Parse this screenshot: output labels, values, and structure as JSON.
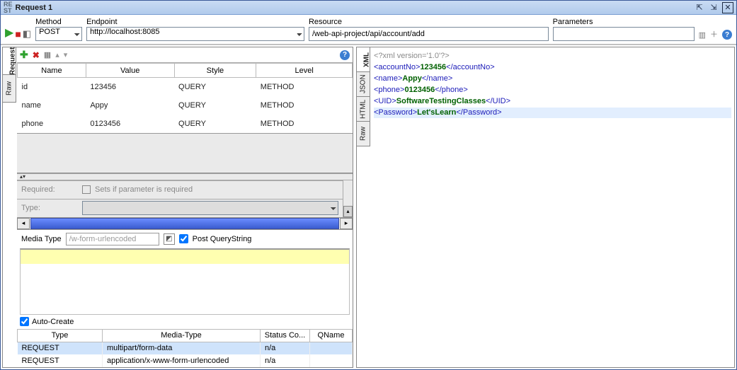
{
  "title": "Request 1",
  "urlbar": {
    "method_label": "Method",
    "method_value": "POST",
    "endpoint_label": "Endpoint",
    "endpoint_value": "http://localhost:8085",
    "resource_label": "Resource",
    "resource_value": "/web-api-project/api/account/add",
    "params_label": "Parameters",
    "params_value": ""
  },
  "left_tabs": [
    "Request",
    "Raw"
  ],
  "param_headers": [
    "Name",
    "Value",
    "Style",
    "Level"
  ],
  "params": [
    {
      "name": "id",
      "value": "123456",
      "style": "QUERY",
      "level": "METHOD"
    },
    {
      "name": "name",
      "value": "Appy",
      "style": "QUERY",
      "level": "METHOD"
    },
    {
      "name": "phone",
      "value": "0123456",
      "style": "QUERY",
      "level": "METHOD"
    }
  ],
  "props": {
    "required_label": "Required:",
    "required_check_label": "Sets if parameter is required",
    "type_label": "Type:"
  },
  "media": {
    "label": "Media Type",
    "value": "/w-form-urlencoded",
    "post_qs_label": "Post QueryString"
  },
  "auto_create_label": "Auto-Create",
  "attach_headers": [
    "Type",
    "Media-Type",
    "Status Co...",
    "QName"
  ],
  "attachments": [
    {
      "type": "REQUEST",
      "media": "multipart/form-data",
      "status": "n/a",
      "qname": ""
    },
    {
      "type": "REQUEST",
      "media": "application/x-www-form-urlencoded",
      "status": "n/a",
      "qname": ""
    }
  ],
  "right_tabs": [
    "XML",
    "JSON",
    "HTML",
    "Raw"
  ],
  "response": {
    "decl": "<?xml version='1.0'?>",
    "lines": [
      {
        "o": "<accountNo>",
        "v": "123456",
        "c": "</accountNo>"
      },
      {
        "o": "<name>",
        "v": "Appy",
        "c": "</name>"
      },
      {
        "o": "<phone>",
        "v": "0123456",
        "c": "</phone>"
      },
      {
        "o": "<UID>",
        "v": "SoftwareTestingClasses",
        "c": "</UID>"
      },
      {
        "o": "<Password>",
        "v": "Let'sLearn",
        "c": "</Password>"
      }
    ]
  }
}
